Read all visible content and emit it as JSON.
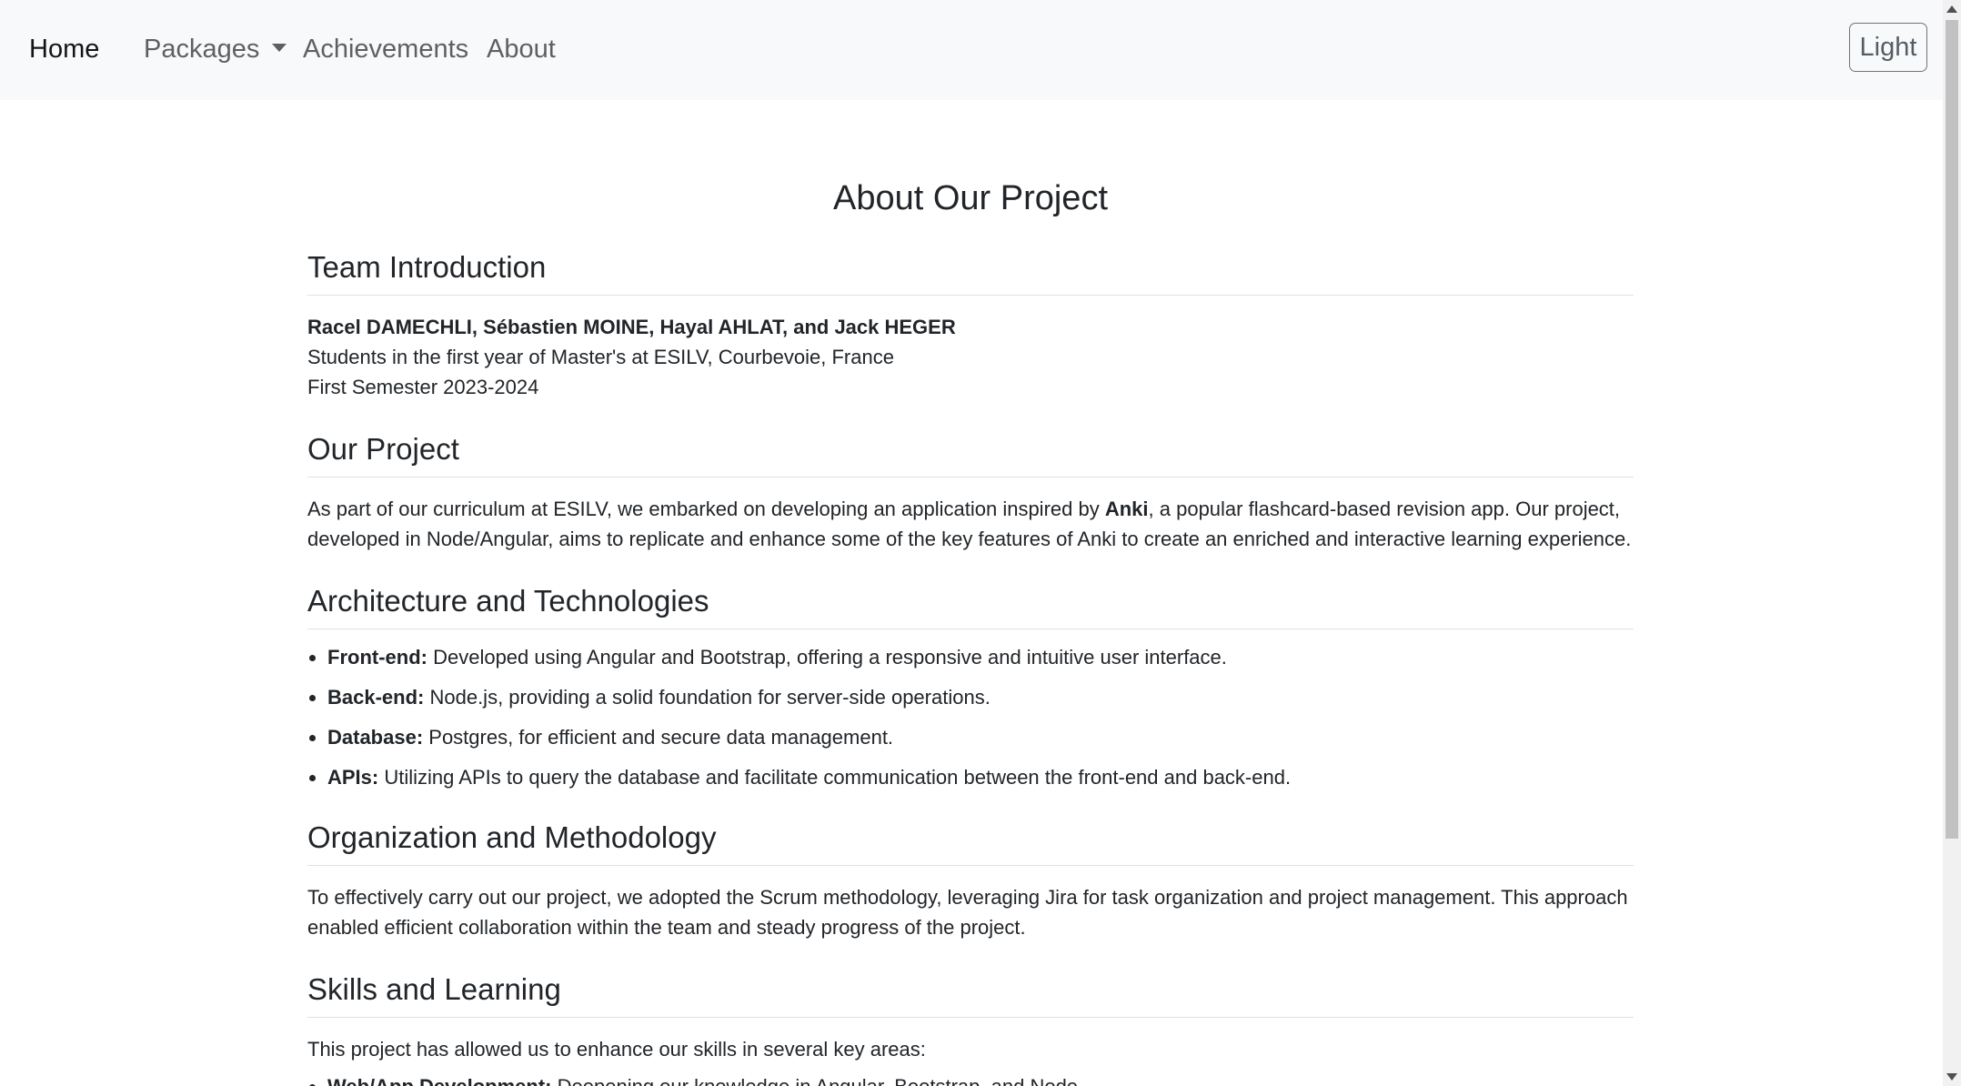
{
  "nav": {
    "home": "Home",
    "packages": "Packages",
    "achievements": "Achievements",
    "about": "About",
    "theme_button": "Light"
  },
  "page": {
    "title": "About Our Project"
  },
  "team": {
    "heading": "Team Introduction",
    "names": "Racel DAMECHLI, Sébastien MOINE, Hayal AHLAT, and Jack HEGER",
    "line1": "Students in the first year of Master's at ESILV, Courbevoie, France",
    "line2": "First Semester 2023-2024"
  },
  "project": {
    "heading": "Our Project",
    "text_before": "As part of our curriculum at ESILV, we embarked on developing an application inspired by ",
    "bold_word": "Anki",
    "text_after": ", a popular flashcard-based revision app. Our project, developed in Node/Angular, aims to replicate and enhance some of the key features of Anki to create an enriched and interactive learning experience."
  },
  "architecture": {
    "heading": "Architecture and Technologies",
    "items": [
      {
        "label": "Front-end:",
        "text": " Developed using Angular and Bootstrap, offering a responsive and intuitive user interface."
      },
      {
        "label": "Back-end:",
        "text": " Node.js, providing a solid foundation for server-side operations."
      },
      {
        "label": "Database:",
        "text": " Postgres, for efficient and secure data management."
      },
      {
        "label": "APIs:",
        "text": " Utilizing APIs to query the database and facilitate communication between the front-end and back-end."
      }
    ]
  },
  "organization": {
    "heading": "Organization and Methodology",
    "text": "To effectively carry out our project, we adopted the Scrum methodology, leveraging Jira for task organization and project management. This approach enabled efficient collaboration within the team and steady progress of the project."
  },
  "skills": {
    "heading": "Skills and Learning",
    "intro": "This project has allowed us to enhance our skills in several key areas:",
    "items": [
      {
        "label": "Web/App Development:",
        "text": " Deepening our knowledge in Angular, Bootstrap, and Node."
      }
    ]
  },
  "colors": {
    "navbar_bg": "#f8f9fa",
    "text": "#212529",
    "divider": "#dee2e6"
  }
}
